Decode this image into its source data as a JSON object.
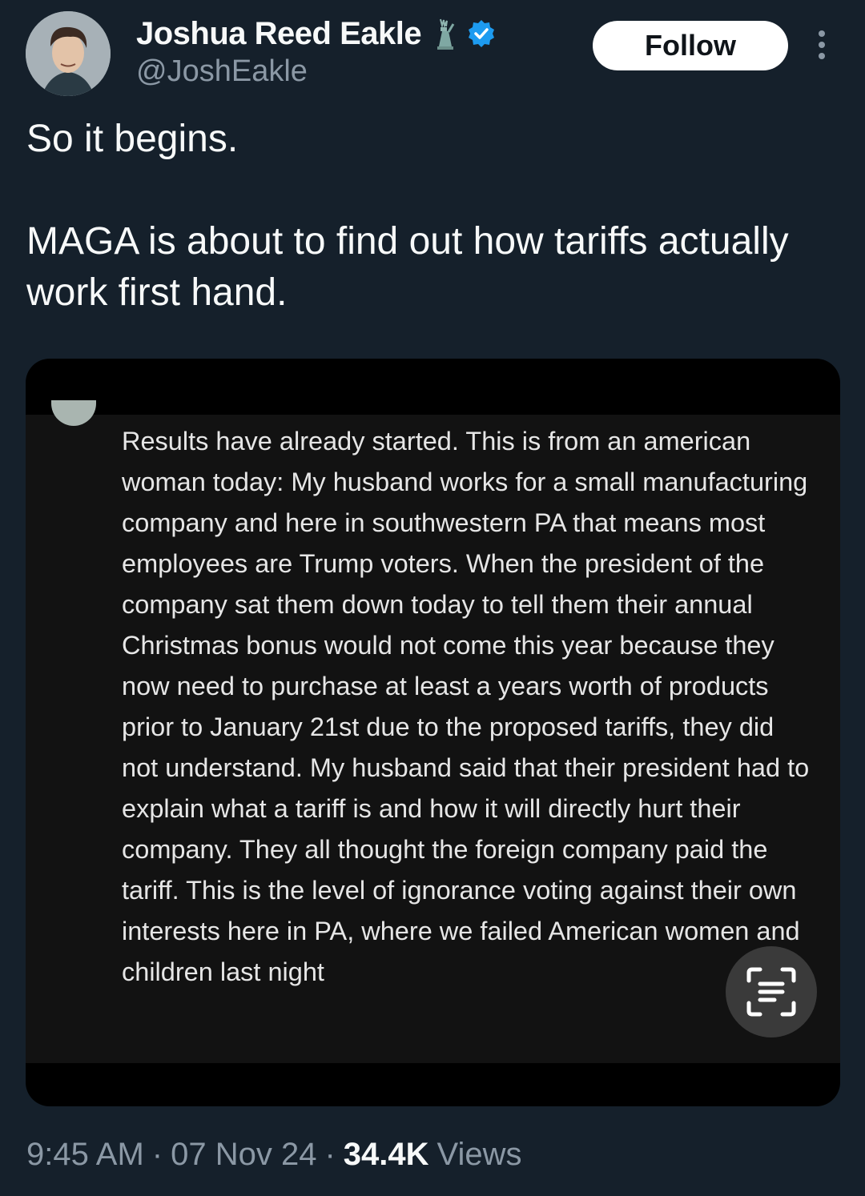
{
  "author": {
    "display_name": "Joshua Reed Eakle",
    "handle": "@JoshEakle",
    "badges": [
      "statue-of-liberty-icon",
      "verified-badge-icon"
    ],
    "verified_color": "#1d9bf0"
  },
  "actions": {
    "follow_label": "Follow",
    "more_icon": "more-vertical-icon"
  },
  "tweet": {
    "text": "So it begins.\n\nMAGA is about to find out how tariffs actually work first hand."
  },
  "media": {
    "comment_text": "Results have already started.  This is from an american woman today: My husband works for a small manufacturing company and here in southwestern PA that means most employees are Trump voters. When the president of the company sat them down today to tell them their annual Christmas bonus would not come this year because they now need to purchase at least a years worth of products prior to January 21st due to the proposed tariffs, they did not understand. My husband said that their president had to explain what a tariff is and how it will directly hurt their company. They all thought the foreign company paid the tariff. This is the level of ignorance voting against their own interests here in PA, where we failed American women and children last night",
    "overlay_icon": "text-scan-icon"
  },
  "meta": {
    "time": "9:45 AM",
    "date": "07 Nov 24",
    "separator": "·",
    "views_count": "34.4K",
    "views_label": "Views"
  },
  "colors": {
    "background": "#15202b",
    "text_primary": "#f7f9f9",
    "text_secondary": "#8b98a5",
    "follow_bg": "#ffffff"
  }
}
